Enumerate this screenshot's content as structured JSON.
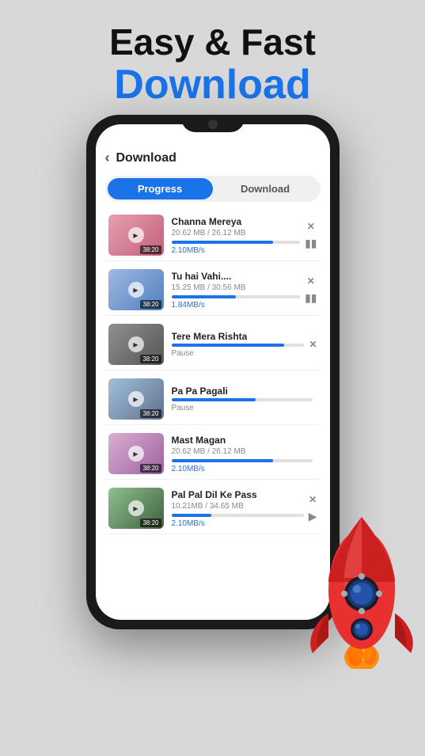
{
  "header": {
    "line1": "Easy & Fast",
    "line2": "Download"
  },
  "screen": {
    "title": "Download",
    "tabs": [
      {
        "label": "Progress",
        "active": true
      },
      {
        "label": "Download",
        "active": false
      }
    ],
    "items": [
      {
        "id": 1,
        "title": "Channa Mereya",
        "size": "20.62 MB / 26.12 MB",
        "speed": "2.10MB/s",
        "progress": 79,
        "status": "downloading",
        "time": "38:20",
        "thumb_class": "t1"
      },
      {
        "id": 2,
        "title": "Tu hai Vahi....",
        "size": "15.25 MB / 30.56 MB",
        "speed": "1.84MB/s",
        "progress": 50,
        "status": "downloading",
        "time": "38:20",
        "thumb_class": "t2"
      },
      {
        "id": 3,
        "title": "Tere Mera Rishta",
        "size": "",
        "speed": "",
        "progress": 85,
        "status": "Pause",
        "time": "38:20",
        "thumb_class": "t3"
      },
      {
        "id": 4,
        "title": "Pa Pa Pagali",
        "size": "",
        "speed": "",
        "progress": 60,
        "status": "Pause",
        "time": "38:20",
        "thumb_class": "t4"
      },
      {
        "id": 5,
        "title": "Mast Magan",
        "size": "20.62 MB / 26.12 MB",
        "speed": "2.10MB/s",
        "progress": 72,
        "status": "downloading",
        "time": "38:20",
        "thumb_class": "t5"
      },
      {
        "id": 6,
        "title": "Pal Pal Dil Ke Pass",
        "size": "10.21MB / 34.65 MB",
        "speed": "2.10MB/s",
        "progress": 30,
        "status": "downloading",
        "time": "38:20",
        "thumb_class": "t6"
      }
    ]
  }
}
